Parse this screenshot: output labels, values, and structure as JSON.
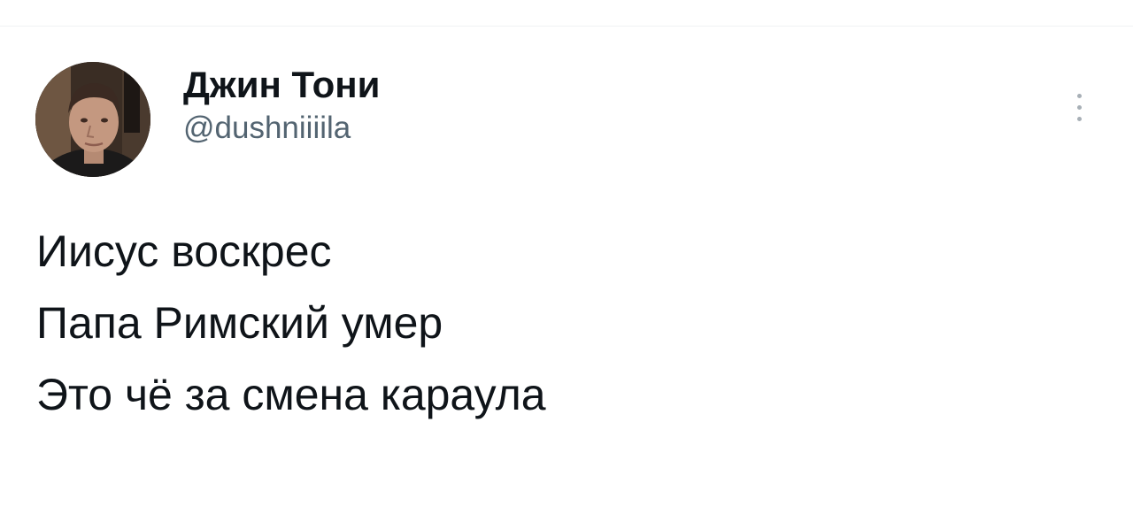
{
  "author": {
    "display_name": "Джин Тони",
    "handle": "@dushniiiila"
  },
  "tweet": {
    "lines": [
      "Иисус воскрес",
      "Папа Римский умер",
      "Это чё за смена караула"
    ]
  },
  "icons": {
    "avatar": "user-photo",
    "more": "vertical-ellipsis-icon"
  },
  "colors": {
    "text": "#0f1419",
    "secondary_text": "#536471",
    "background": "#ffffff"
  }
}
